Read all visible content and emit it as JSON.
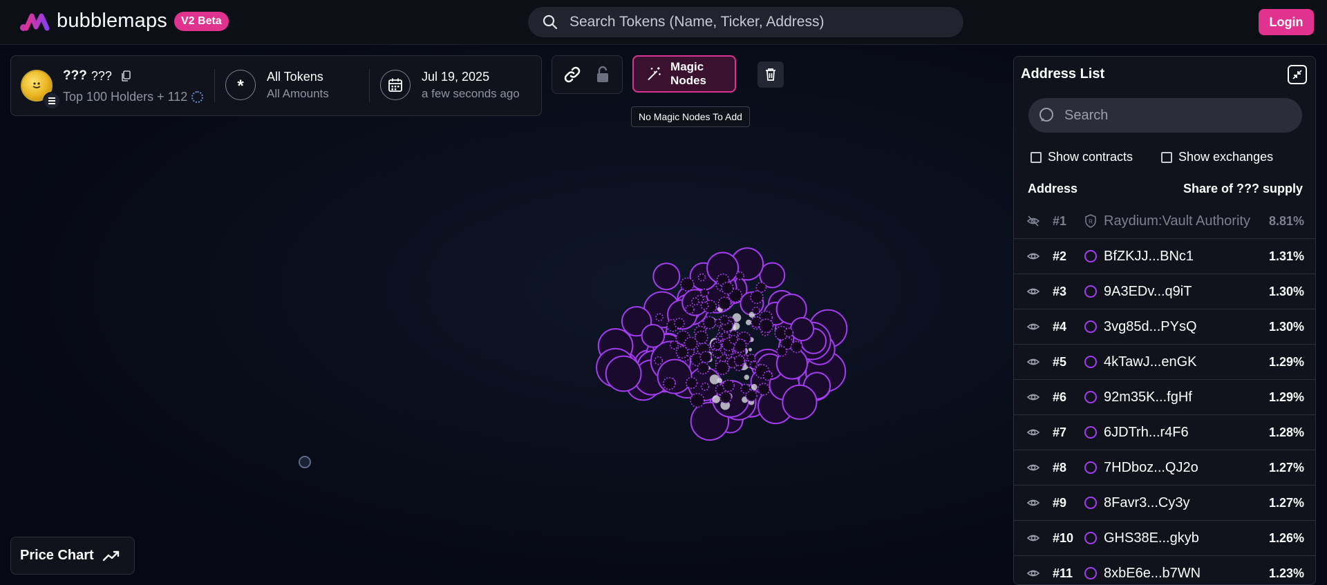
{
  "app": {
    "name": "bubblemaps",
    "badge": "V2 Beta"
  },
  "top_search": {
    "placeholder": "Search Tokens (Name, Ticker, Address)"
  },
  "login_label": "Login",
  "token": {
    "name": "???",
    "symbol": "???",
    "holders_label": "Top 100 Holders + 112"
  },
  "filters": {
    "tokens_title": "All Tokens",
    "tokens_sub": "All Amounts",
    "date_title": "Jul 19, 2025",
    "date_sub": "a few seconds ago"
  },
  "toolbar": {
    "magic_nodes_label": "Magic Nodes",
    "tooltip": "No Magic Nodes To Add"
  },
  "price_chart_label": "Price Chart",
  "address_list": {
    "title": "Address List",
    "search_placeholder": "Search",
    "show_contracts": "Show contracts",
    "show_exchanges": "Show exchanges",
    "col_address": "Address",
    "col_share": "Share of ??? supply",
    "rows": [
      {
        "rank": "#1",
        "address": "Raydium:Vault Authority",
        "share": "8.81%",
        "hidden": true
      },
      {
        "rank": "#2",
        "address": "BfZKJJ...BNc1",
        "share": "1.31%"
      },
      {
        "rank": "#3",
        "address": "9A3EDv...q9iT",
        "share": "1.30%"
      },
      {
        "rank": "#4",
        "address": "3vg85d...PYsQ",
        "share": "1.30%"
      },
      {
        "rank": "#5",
        "address": "4kTawJ...enGK",
        "share": "1.29%"
      },
      {
        "rank": "#6",
        "address": "92m35K...fgHf",
        "share": "1.29%"
      },
      {
        "rank": "#7",
        "address": "6JDTrh...r4F6",
        "share": "1.28%"
      },
      {
        "rank": "#8",
        "address": "7HDboz...QJ2o",
        "share": "1.27%"
      },
      {
        "rank": "#9",
        "address": "8Favr3...Cy3y",
        "share": "1.27%"
      },
      {
        "rank": "#10",
        "address": "GHS38E...gkyb",
        "share": "1.26%"
      },
      {
        "rank": "#11",
        "address": "8xbE6e...b7WN",
        "share": "1.23%"
      }
    ]
  },
  "colors": {
    "accent": "#e0338f",
    "bubble": "#a43cf0",
    "background": "#060913"
  }
}
